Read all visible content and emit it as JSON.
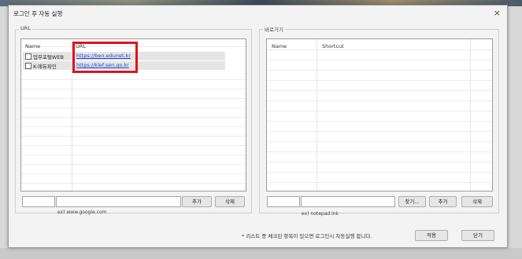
{
  "window": {
    "title": "로그인 후 자동 실행",
    "close_symbol": "×"
  },
  "url_group": {
    "label": "URL",
    "columns": {
      "name": "Name",
      "url": "URL"
    },
    "rows": [
      {
        "name": "업무포털WEB",
        "url": "https://ben.edunet.kr",
        "checked": false
      },
      {
        "name": "K-에듀파인",
        "url": "https://klef.sen.go.kr",
        "checked": false
      }
    ],
    "input_value": "",
    "add_label": "추가",
    "delete_label": "삭제",
    "hint": "ex) www.google.com"
  },
  "shortcut_group": {
    "label": "바로가기",
    "columns": {
      "name": "Name",
      "shortcut": "Shortcut"
    },
    "input_value": "",
    "browse_label": "찾기...",
    "add_label": "추가",
    "delete_label": "삭제",
    "hint": "ex) notepad.lnk"
  },
  "footer": {
    "note": "* 리스트 중 체크된 항목이 있으면 로그인시 자동실행 합니다.",
    "apply_label": "적용",
    "close_label": "닫기"
  },
  "colors": {
    "highlight": "#e0121b",
    "link": "#1a3fd0"
  }
}
